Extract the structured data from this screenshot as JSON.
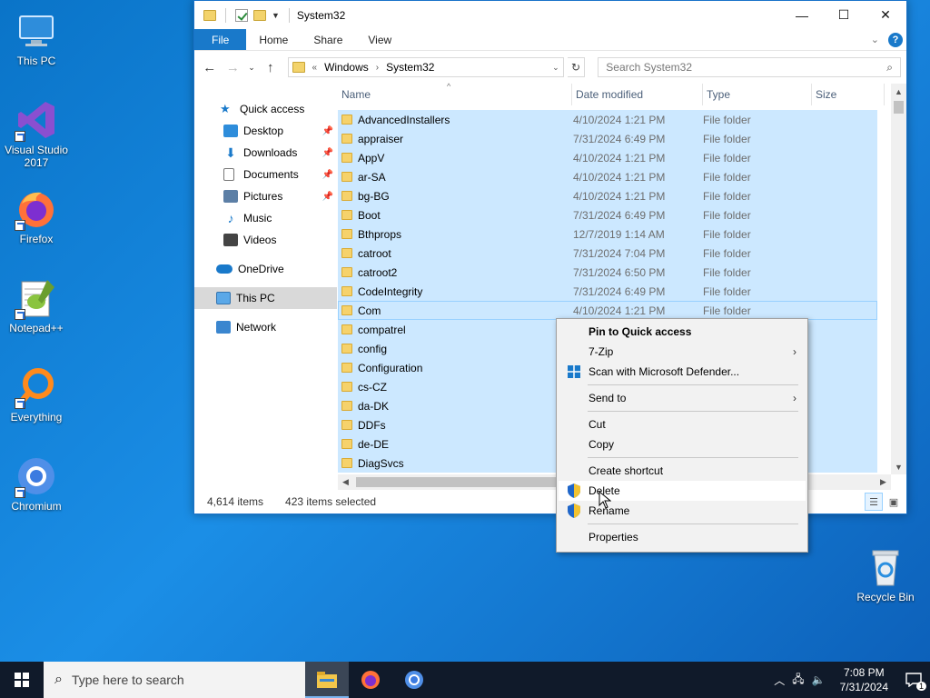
{
  "desktop": {
    "icons": [
      {
        "label": "This PC"
      },
      {
        "label": "Visual Studio 2017"
      },
      {
        "label": "Firefox"
      },
      {
        "label": "Notepad++"
      },
      {
        "label": "Everything"
      },
      {
        "label": "Chromium"
      },
      {
        "label": "Recycle Bin"
      }
    ]
  },
  "window": {
    "title": "System32",
    "ribbon_tabs": [
      "File",
      "Home",
      "Share",
      "View"
    ],
    "address": {
      "overflow": "«",
      "crumbs": [
        "Windows",
        "System32"
      ]
    },
    "search_placeholder": "Search System32",
    "nav": {
      "items": [
        {
          "label": "Quick access"
        },
        {
          "label": "Desktop"
        },
        {
          "label": "Downloads"
        },
        {
          "label": "Documents"
        },
        {
          "label": "Pictures"
        },
        {
          "label": "Music"
        },
        {
          "label": "Videos"
        },
        {
          "label": "OneDrive"
        },
        {
          "label": "This PC"
        },
        {
          "label": "Network"
        }
      ]
    },
    "columns": {
      "name": "Name",
      "date": "Date modified",
      "type": "Type",
      "size": "Size"
    },
    "files": [
      {
        "name": "AdvancedInstallers",
        "date": "4/10/2024 1:21 PM",
        "type": "File folder"
      },
      {
        "name": "appraiser",
        "date": "7/31/2024 6:49 PM",
        "type": "File folder"
      },
      {
        "name": "AppV",
        "date": "4/10/2024 1:21 PM",
        "type": "File folder"
      },
      {
        "name": "ar-SA",
        "date": "4/10/2024 1:21 PM",
        "type": "File folder"
      },
      {
        "name": "bg-BG",
        "date": "4/10/2024 1:21 PM",
        "type": "File folder"
      },
      {
        "name": "Boot",
        "date": "7/31/2024 6:49 PM",
        "type": "File folder"
      },
      {
        "name": "Bthprops",
        "date": "12/7/2019 1:14 AM",
        "type": "File folder"
      },
      {
        "name": "catroot",
        "date": "7/31/2024 7:04 PM",
        "type": "File folder"
      },
      {
        "name": "catroot2",
        "date": "7/31/2024 6:50 PM",
        "type": "File folder"
      },
      {
        "name": "CodeIntegrity",
        "date": "7/31/2024 6:49 PM",
        "type": "File folder"
      },
      {
        "name": "Com",
        "date": "4/10/2024 1:21 PM",
        "type": "File folder"
      },
      {
        "name": "compatrel",
        "date": "",
        "type": ""
      },
      {
        "name": "config",
        "date": "",
        "type": ""
      },
      {
        "name": "Configuration",
        "date": "",
        "type": ""
      },
      {
        "name": "cs-CZ",
        "date": "",
        "type": ""
      },
      {
        "name": "da-DK",
        "date": "",
        "type": ""
      },
      {
        "name": "DDFs",
        "date": "",
        "type": ""
      },
      {
        "name": "de-DE",
        "date": "",
        "type": ""
      },
      {
        "name": "DiagSvcs",
        "date": "",
        "type": ""
      }
    ],
    "status": {
      "items": "4,614 items",
      "selected": "423 items selected"
    }
  },
  "context_menu": {
    "items": [
      {
        "label": "Pin to Quick access"
      },
      {
        "label": "7-Zip"
      },
      {
        "label": "Scan with Microsoft Defender..."
      },
      {
        "label": "Send to"
      },
      {
        "label": "Cut"
      },
      {
        "label": "Copy"
      },
      {
        "label": "Create shortcut"
      },
      {
        "label": "Delete"
      },
      {
        "label": "Rename"
      },
      {
        "label": "Properties"
      }
    ]
  },
  "taskbar": {
    "search_placeholder": "Type here to search",
    "time": "7:08 PM",
    "date": "7/31/2024",
    "notification_count": "1"
  },
  "colors": {
    "accent": "#1979ca",
    "selection": "#cce8ff",
    "taskbar": "#101a2a"
  }
}
